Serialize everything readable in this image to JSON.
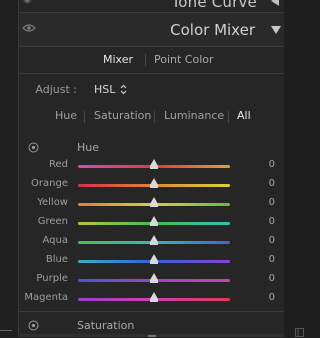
{
  "previous_panel": {
    "title": "Tone Curve"
  },
  "panel": {
    "title": "Color Mixer"
  },
  "modes": {
    "mixer": "Mixer",
    "point_color": "Point Color",
    "active": "Mixer"
  },
  "adjust": {
    "label": "Adjust :",
    "value": "HSL"
  },
  "subtabs": [
    {
      "label": "Hue",
      "active": false
    },
    {
      "label": "Saturation",
      "active": false
    },
    {
      "label": "Luminance",
      "active": false
    },
    {
      "label": "All",
      "active": true
    }
  ],
  "sections": {
    "hue": {
      "title": "Hue"
    },
    "saturation": {
      "title": "Saturation"
    }
  },
  "sliders": [
    {
      "label": "Red",
      "value": "0",
      "level": 0.5,
      "gradient": [
        "#d24bb8",
        "#e23b3b",
        "#e0a03a"
      ]
    },
    {
      "label": "Orange",
      "value": "0",
      "level": 0.5,
      "gradient": [
        "#d8304a",
        "#e08a2e",
        "#d8d23a"
      ]
    },
    {
      "label": "Yellow",
      "value": "0",
      "level": 0.5,
      "gradient": [
        "#e07f2e",
        "#d6d03a",
        "#5fc040"
      ]
    },
    {
      "label": "Green",
      "value": "0",
      "level": 0.5,
      "gradient": [
        "#b8c63a",
        "#3fbf52",
        "#37bfb0"
      ]
    },
    {
      "label": "Aqua",
      "value": "0",
      "level": 0.5,
      "gradient": [
        "#45c050",
        "#35b8b8",
        "#3a66d8"
      ]
    },
    {
      "label": "Blue",
      "value": "0",
      "level": 0.5,
      "gradient": [
        "#36b0c8",
        "#3560d8",
        "#8a44d0"
      ]
    },
    {
      "label": "Purple",
      "value": "0",
      "level": 0.5,
      "gradient": [
        "#4a54d8",
        "#9a44d0",
        "#d040a8"
      ]
    },
    {
      "label": "Magenta",
      "value": "0",
      "level": 0.5,
      "gradient": [
        "#9a3fd0",
        "#d23cb0",
        "#e0385a"
      ]
    }
  ],
  "colors": {
    "panel_bg": "#262626",
    "header_bg": "#2a2a2a",
    "thumb": "#d8d8d8"
  },
  "icons": {
    "eye": "eye-icon",
    "collapse": "triangle-down-icon",
    "target": "target-adjust-icon",
    "updown": "up-down-chevron-icon"
  }
}
